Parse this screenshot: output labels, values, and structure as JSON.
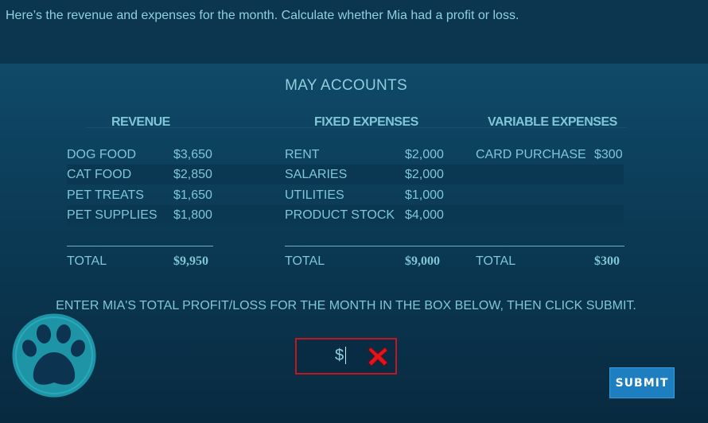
{
  "instruction": "Here’s the revenue and expenses for the month. Calculate whether Mia had a profit or loss.",
  "accounts": {
    "title": "MAY ACCOUNTS",
    "revenue": {
      "heading": "REVENUE",
      "items": [
        {
          "label": "DOG FOOD",
          "value": "$3,650"
        },
        {
          "label": "CAT FOOD",
          "value": "$2,850"
        },
        {
          "label": "PET TREATS",
          "value": "$1,650"
        },
        {
          "label": "PET SUPPLIES",
          "value": "$1,800"
        }
      ],
      "total_label": "TOTAL",
      "total_value": "$9,950"
    },
    "fixed": {
      "heading": "FIXED EXPENSES",
      "items": [
        {
          "label": "RENT",
          "value": "$2,000"
        },
        {
          "label": "SALARIES",
          "value": "$2,000"
        },
        {
          "label": "UTILITIES",
          "value": "$1,000"
        },
        {
          "label": "PRODUCT STOCK",
          "value": "$4,000"
        }
      ],
      "total_label": "TOTAL",
      "total_value": "$9,000"
    },
    "variable": {
      "heading": "VARIABLE EXPENSES",
      "items": [
        {
          "label": "CARD PURCHASE",
          "value": "$300"
        }
      ],
      "total_label": "TOTAL",
      "total_value": "$300"
    }
  },
  "prompt": "ENTER MIA'S TOTAL PROFIT/LOSS FOR THE MONTH IN THE BOX BELOW, THEN CLICK SUBMIT.",
  "answer": {
    "prefix": "$",
    "value": ""
  },
  "submit_label": "SUBMIT",
  "icons": {
    "logo": "paw-print-icon",
    "clear": "red-x-icon"
  },
  "colors": {
    "background": "#0c3450",
    "text": "#7fc6d6",
    "submit": "#1d7fc0",
    "error": "#c0181d"
  }
}
